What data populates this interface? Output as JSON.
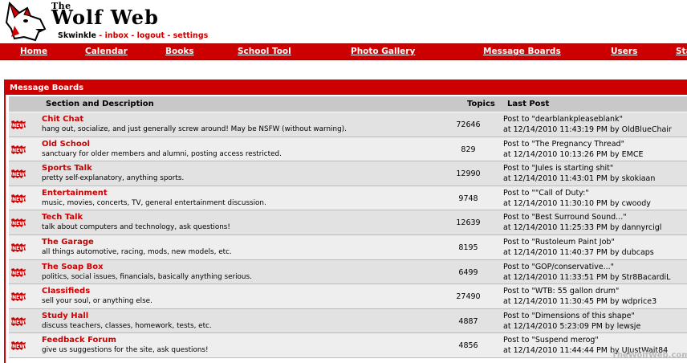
{
  "site": {
    "the": "The",
    "name": "Wolf Web"
  },
  "user": {
    "name": "Skwinkle",
    "links": [
      "inbox",
      "logout",
      "settings"
    ],
    "separator": "-"
  },
  "nav": [
    "Home",
    "Calendar",
    "Books",
    "School Tool",
    "Photo Gallery",
    "Message Boards",
    "Users",
    "Sta"
  ],
  "board": {
    "title": "Message Boards",
    "columns": {
      "section": "Section and Description",
      "topics": "Topics",
      "last": "Last Post"
    },
    "rows": [
      {
        "name": "Chit Chat",
        "desc": "hang out, socialize, and just generally screw around! May be NSFW (without warning).",
        "topics": "72646",
        "last1": "Post to \"dearblankpleaseblank\"",
        "last2": "at 12/14/2010 11:43:19 PM by OldBlueChair"
      },
      {
        "name": "Old School",
        "desc": "sanctuary for older members and alumni, posting access restricted.",
        "topics": "829",
        "last1": "Post to \"The Pregnancy Thread\"",
        "last2": "at 12/14/2010 10:13:26 PM by EMCE"
      },
      {
        "name": "Sports Talk",
        "desc": "pretty self-explanatory, anything sports.",
        "topics": "12990",
        "last1": "Post to \"Jules is starting shit\"",
        "last2": "at 12/14/2010 11:43:01 PM by skokiaan"
      },
      {
        "name": "Entertainment",
        "desc": "music, movies, concerts, TV, general entertainment discussion.",
        "topics": "9748",
        "last1": "Post to \"\"Call of Duty:\"",
        "last2": "at 12/14/2010 11:30:10 PM by cwoody"
      },
      {
        "name": "Tech Talk",
        "desc": "talk about computers and technology, ask questions!",
        "topics": "12639",
        "last1": "Post to \"Best Surround Sound...\"",
        "last2": "at 12/14/2010 11:25:33 PM by dannyrcigl"
      },
      {
        "name": "The Garage",
        "desc": "all things automotive, racing, mods, new models, etc.",
        "topics": "8195",
        "last1": "Post to \"Rustoleum Paint Job\"",
        "last2": "at 12/14/2010 11:40:37 PM by dubcaps"
      },
      {
        "name": "The Soap Box",
        "desc": "politics, social issues, financials, basically anything serious.",
        "topics": "6499",
        "last1": "Post to \"GOP/conservative...\"",
        "last2": "at 12/14/2010 11:33:51 PM by Str8BacardiL"
      },
      {
        "name": "Classifieds",
        "desc": "sell your soul, or anything else.",
        "topics": "27490",
        "last1": "Post to \"WTB: 55 gallon drum\"",
        "last2": "at 12/14/2010 11:30:45 PM by wdprice3"
      },
      {
        "name": "Study Hall",
        "desc": "discuss teachers, classes, homework, tests, etc.",
        "topics": "4887",
        "last1": "Post to \"Dimensions of this shape\"",
        "last2": "at 12/14/2010 5:23:09 PM by lewsje"
      },
      {
        "name": "Feedback Forum",
        "desc": "give us suggestions for the site, ask questions!",
        "topics": "4856",
        "last1": "Post to \"Suspend merog\"",
        "last2": "at 12/14/2010 11:44:44 PM by UJustWait84"
      }
    ]
  },
  "watermark": "TheWolfWeb.com",
  "colors": {
    "accent": "#cc0000",
    "row_odd": "#e2e2e2",
    "row_even": "#eeeeee",
    "header_row": "#c8c8c8"
  }
}
